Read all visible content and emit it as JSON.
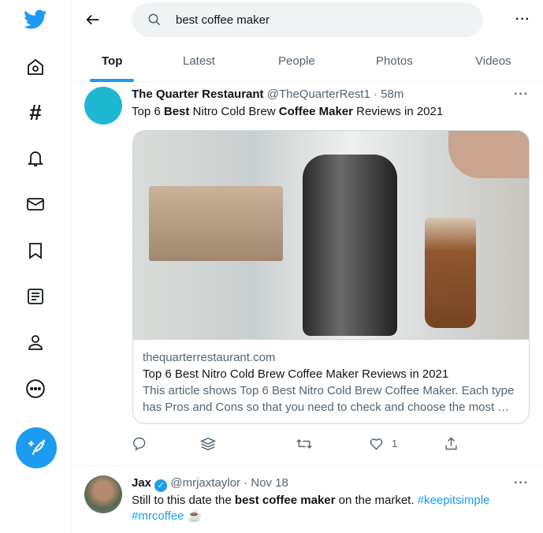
{
  "search": {
    "query": "best coffee maker"
  },
  "tabs": [
    {
      "label": "Top"
    },
    {
      "label": "Latest"
    },
    {
      "label": "People"
    },
    {
      "label": "Photos"
    },
    {
      "label": "Videos"
    }
  ],
  "colors": {
    "accent": "#1d9bf0",
    "muted": "#536471"
  },
  "tweets": [
    {
      "name": "The Quarter Restaurant",
      "handle": "@TheQuarterRest1",
      "time": "· 58m",
      "text": [
        {
          "t": "Top 6 "
        },
        {
          "t": "Best",
          "b": true
        },
        {
          "t": " Nitro Cold Brew "
        },
        {
          "t": "Coffee Maker",
          "b": true
        },
        {
          "t": " Reviews in 2021"
        }
      ],
      "card": {
        "domain": "thequarterrestaurant.com",
        "title": "Top 6 Best Nitro Cold Brew Coffee Maker Reviews in 2021",
        "description": "This article shows Top 6 Best Nitro Cold Brew Coffee Maker. Each type has Pros and Cons so that you need to check and choose the most …"
      },
      "likes": "1"
    },
    {
      "name": "Jax",
      "handle": "@mrjaxtaylor",
      "time": "· Nov 18",
      "verified": true,
      "text": [
        {
          "t": "Still to this date the "
        },
        {
          "t": "best coffee maker",
          "b": true
        },
        {
          "t": " on the market. "
        },
        {
          "t": "#keepitsimple",
          "l": true
        },
        {
          "t": " "
        },
        {
          "t": "#mrcoffee",
          "l": true
        },
        {
          "t": " ☕"
        }
      ]
    }
  ]
}
